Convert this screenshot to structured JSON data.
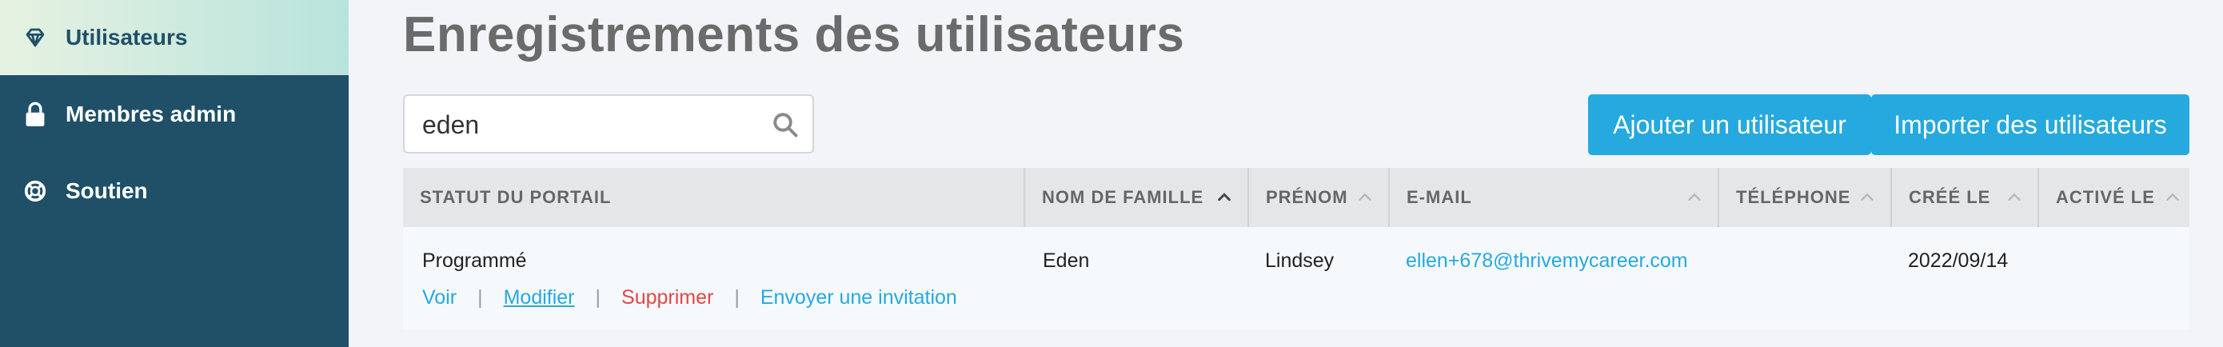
{
  "sidebar": {
    "items": [
      {
        "label": "Utilisateurs",
        "icon": "diamond-icon",
        "active": true
      },
      {
        "label": "Membres admin",
        "icon": "lock-icon",
        "active": false
      },
      {
        "label": "Soutien",
        "icon": "lifebuoy-icon",
        "active": false
      }
    ]
  },
  "main": {
    "title": "Enregistrements des utilisateurs",
    "search": {
      "value": "eden",
      "icon": "search-icon"
    },
    "buttons": {
      "add_user": "Ajouter un utilisateur",
      "import_users": "Importer des utilisateurs"
    },
    "table": {
      "columns": [
        {
          "label": "STATUT DU PORTAIL",
          "sortable": false
        },
        {
          "label": "NOM DE FAMILLE",
          "sortable": true,
          "sort": "active"
        },
        {
          "label": "PRÉNOM",
          "sortable": true
        },
        {
          "label": "E-MAIL",
          "sortable": true
        },
        {
          "label": "TÉLÉPHONE",
          "sortable": true
        },
        {
          "label": "CRÉÉ LE",
          "sortable": true
        },
        {
          "label": "ACTIVÉ LE",
          "sortable": true
        }
      ],
      "rows": [
        {
          "status": "Programmé",
          "last_name": "Eden",
          "first_name": "Lindsey",
          "email": "ellen+678@thrivemycareer.com",
          "phone": "",
          "created": "2022/09/14",
          "activated": "",
          "actions": {
            "view": "Voir",
            "edit": "Modifier",
            "delete": "Supprimer",
            "invite": "Envoyer une invitation",
            "separator": "|"
          }
        }
      ]
    }
  },
  "colors": {
    "sidebar_bg": "#1f5068",
    "accent": "#25a9df",
    "danger": "#e04848",
    "title": "#6b6b6b"
  }
}
